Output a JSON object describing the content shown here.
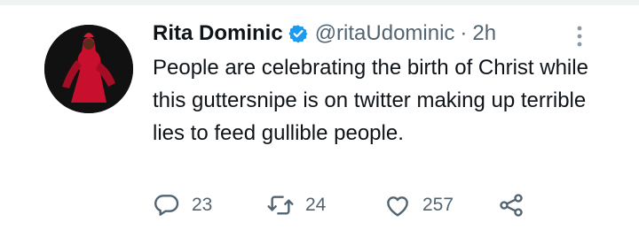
{
  "tweet": {
    "display_name": "Rita Dominic",
    "handle": "@ritaUdominic",
    "separator": "·",
    "time": "2h",
    "text": "People are celebrating the birth of Christ while this guttersnipe is on twitter making up terrible lies to feed gullible people.",
    "verified": true
  },
  "actions": {
    "reply_count": "23",
    "retweet_count": "24",
    "like_count": "257"
  },
  "icons": {
    "verified": "verified-badge-icon",
    "more": "more-vertical-icon",
    "reply": "reply-icon",
    "retweet": "retweet-icon",
    "like": "heart-icon",
    "share": "share-icon"
  },
  "colors": {
    "verified_blue": "#1d9bf0",
    "text_primary": "#0f1419",
    "text_secondary": "#536471",
    "avatar_red": "#c8102e"
  }
}
